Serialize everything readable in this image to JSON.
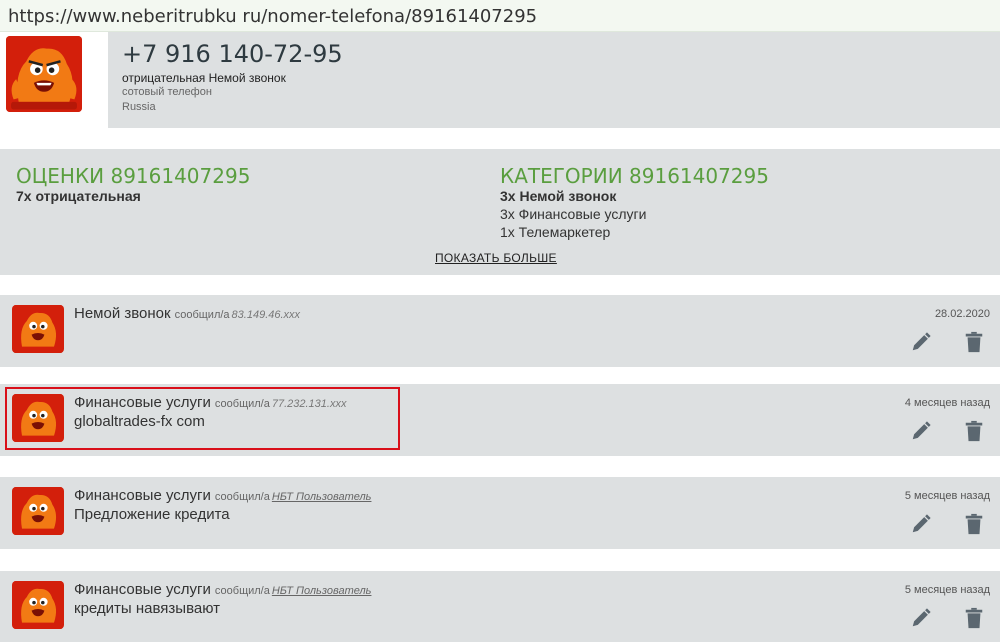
{
  "browser": {
    "url": "https://www.neberitrubku ru/nomer-telefona/89161407295"
  },
  "phone": {
    "number": "+7 916 140-72-95",
    "rating_line": "отрицательная Немой звонок",
    "type": "сотовый телефон",
    "country": "Russia"
  },
  "ratings": {
    "title": "ОЦЕНКИ 89161407295",
    "items": [
      "7x отрицательная"
    ]
  },
  "categories": {
    "title": "КАТЕГОРИИ 89161407295",
    "items": [
      "3x Немой звонок",
      "3x Финансовые услуги",
      "1x Телемаркетер"
    ]
  },
  "show_more_label": "ПОКАЗАТЬ БОЛЬШЕ",
  "comments": [
    {
      "category": "Немой звонок",
      "reported_label": "сообщил/а",
      "source": "83.149.46.xxx",
      "text": "",
      "date": "28.02.2020"
    },
    {
      "category": "Финансовые услуги",
      "reported_label": "сообщил/а",
      "source": "77.232.131.xxx",
      "text": "globaltrades-fx com",
      "date": "4 месяцев назад"
    },
    {
      "category": "Финансовые услуги",
      "reported_label": "сообщил/а",
      "source": "НБТ Пользователь",
      "text": "Предложение кредита",
      "date": "5 месяцев назад"
    },
    {
      "category": "Финансовые услуги",
      "reported_label": "сообщил/а",
      "source": "НБТ Пользователь",
      "text": "кредиты навязывают",
      "date": "5 месяцев назад"
    }
  ],
  "colors": {
    "accent_green": "#5a9e3f",
    "panel_gray": "#dde0e1",
    "highlight_red": "#d9101a",
    "avatar_orange": "#f27a14"
  },
  "icons": {
    "edit": "pencil-icon",
    "delete": "trash-icon",
    "avatar": "mascot-avatar"
  }
}
